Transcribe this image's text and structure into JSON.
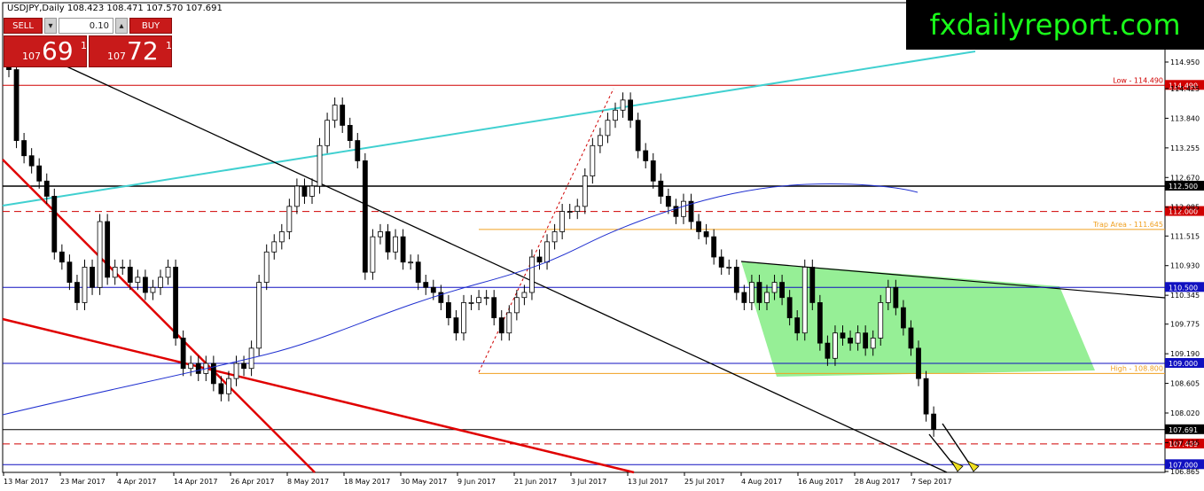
{
  "header": {
    "title": "USDJPY,Daily  108.423 108.471 107.570 107.691"
  },
  "brand": {
    "text": "fxdailyreport.com"
  },
  "trade_panel": {
    "sell_label": "SELL",
    "lot_value": "0.10",
    "buy_label": "BUY",
    "sell_prefix": "107",
    "sell_big": "69",
    "sell_sup": "1",
    "buy_prefix": "107",
    "buy_big": "72",
    "buy_sup": "1"
  },
  "price_axis": {
    "ticks": [
      "114.950",
      "114.425",
      "113.840",
      "113.255",
      "112.670",
      "112.085",
      "111.515",
      "110.930",
      "110.345",
      "109.775",
      "109.190",
      "108.605",
      "108.020",
      "107.435",
      "106.865"
    ]
  },
  "date_axis": {
    "ticks": [
      "13 Mar 2017",
      "23 Mar 2017",
      "4 Apr 2017",
      "14 Apr 2017",
      "26 Apr 2017",
      "8 May 2017",
      "18 May 2017",
      "30 May 2017",
      "9 Jun 2017",
      "21 Jun 2017",
      "3 Jul 2017",
      "13 Jul 2017",
      "25 Jul 2017",
      "4 Aug 2017",
      "16 Aug 2017",
      "28 Aug 2017",
      "7 Sep 2017"
    ]
  },
  "levels": [
    {
      "price": 114.49,
      "tag": "114.490",
      "color": "#d00000",
      "line_label": "Low - 114.490"
    },
    {
      "price": 112.5,
      "tag": "112.500",
      "color": "#000000",
      "line_label": ""
    },
    {
      "price": 112.0,
      "tag": "112.000",
      "color": "#d00000",
      "line_label": ""
    },
    {
      "price": 111.645,
      "tag": "",
      "color": "#f0a020",
      "line_label": "Trap Area - 111.645"
    },
    {
      "price": 110.5,
      "tag": "110.500",
      "color": "#1010c0",
      "line_label": ""
    },
    {
      "price": 109.0,
      "tag": "109.000",
      "color": "#1010c0",
      "line_label": ""
    },
    {
      "price": 108.8,
      "tag": "",
      "color": "#f0a020",
      "line_label": "High - 108.800"
    },
    {
      "price": 107.691,
      "tag": "107.691",
      "color": "#000000",
      "line_label": ""
    },
    {
      "price": 107.409,
      "tag": "107.409",
      "color": "#d00000",
      "line_label": ""
    },
    {
      "price": 107.0,
      "tag": "107.000",
      "color": "#1010c0",
      "line_label": ""
    }
  ],
  "colors": {
    "bull": "#ffffff",
    "bear": "#000000",
    "ma": "#2030d0",
    "channel": "#e00000",
    "trend": "#000000",
    "upper": "#40d0d0",
    "triangle": "#90ee90"
  }
}
